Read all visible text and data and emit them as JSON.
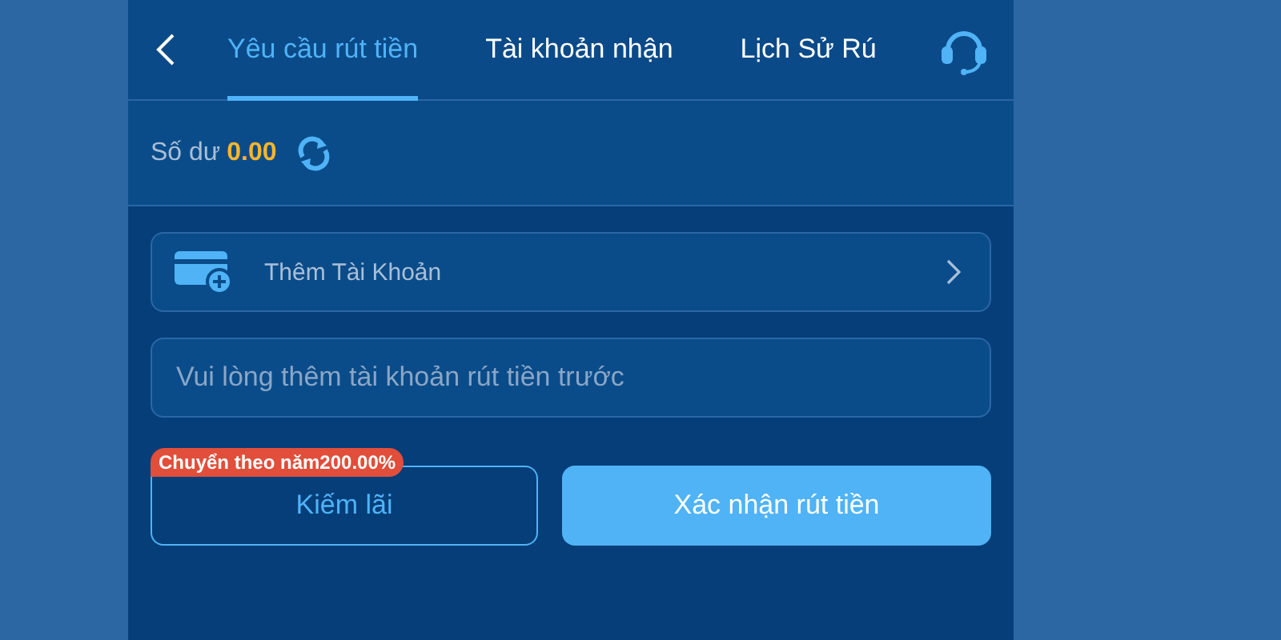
{
  "tabs": [
    {
      "label": "Yêu cầu rút tiền",
      "selected": true
    },
    {
      "label": "Tài khoản nhận",
      "selected": false
    },
    {
      "label": "Lịch Sử Rú",
      "selected": false
    }
  ],
  "balance": {
    "label": "Số dư",
    "value": "0.00"
  },
  "add_account": {
    "label": "Thêm Tài Khoản"
  },
  "amount_field": {
    "placeholder": "Vui lòng thêm tài khoản rút tiền trước"
  },
  "earn_button": {
    "label": "Kiếm lãi",
    "badge": "Chuyển theo năm200.00%"
  },
  "confirm_button": {
    "label": "Xác nhận rút tiền"
  }
}
